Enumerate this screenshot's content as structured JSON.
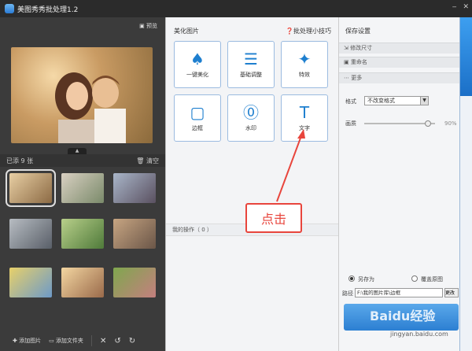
{
  "window": {
    "title": "美图秀秀批处理1.2"
  },
  "left": {
    "preview_label": "预览",
    "added_label": "已添 9 张",
    "clear_label": "清空",
    "add_image_label": "添加图片",
    "add_folder_label": "添加文件夹"
  },
  "mid": {
    "section_title": "美化图片",
    "tips_label": "批处理小技巧",
    "tools": [
      {
        "label": "一键美化",
        "icon": "tulip-icon"
      },
      {
        "label": "基础调整",
        "icon": "sliders-icon"
      },
      {
        "label": "特效",
        "icon": "magic-wand-icon"
      },
      {
        "label": "边框",
        "icon": "frame-icon"
      },
      {
        "label": "水印",
        "icon": "watermark-icon"
      },
      {
        "label": "文字",
        "icon": "text-icon"
      }
    ],
    "my_ops_label": "我的操作（ 0 ）"
  },
  "annotation": {
    "text": "点击",
    "color": "#e8453c"
  },
  "right": {
    "title": "保存设置",
    "acc_resize": "修改尺寸",
    "acc_rename": "重命名",
    "acc_more": "更多",
    "format_label": "格式",
    "format_value": "不改变格式",
    "quality_label": "画质",
    "quality_value": "90%",
    "quality_level": 0.9,
    "save_as_label": "另存为",
    "overwrite_label": "覆盖原图",
    "path_label": "路径",
    "path_value": "F:\\我的图片库\\边框",
    "path_button": "更改"
  },
  "watermark": {
    "text": "Baidu经验",
    "url": "jingyan.baidu.com"
  },
  "colors": {
    "accent": "#1e7fcf",
    "annotation": "#e8453c",
    "dark_panel": "#3b3b3b"
  }
}
